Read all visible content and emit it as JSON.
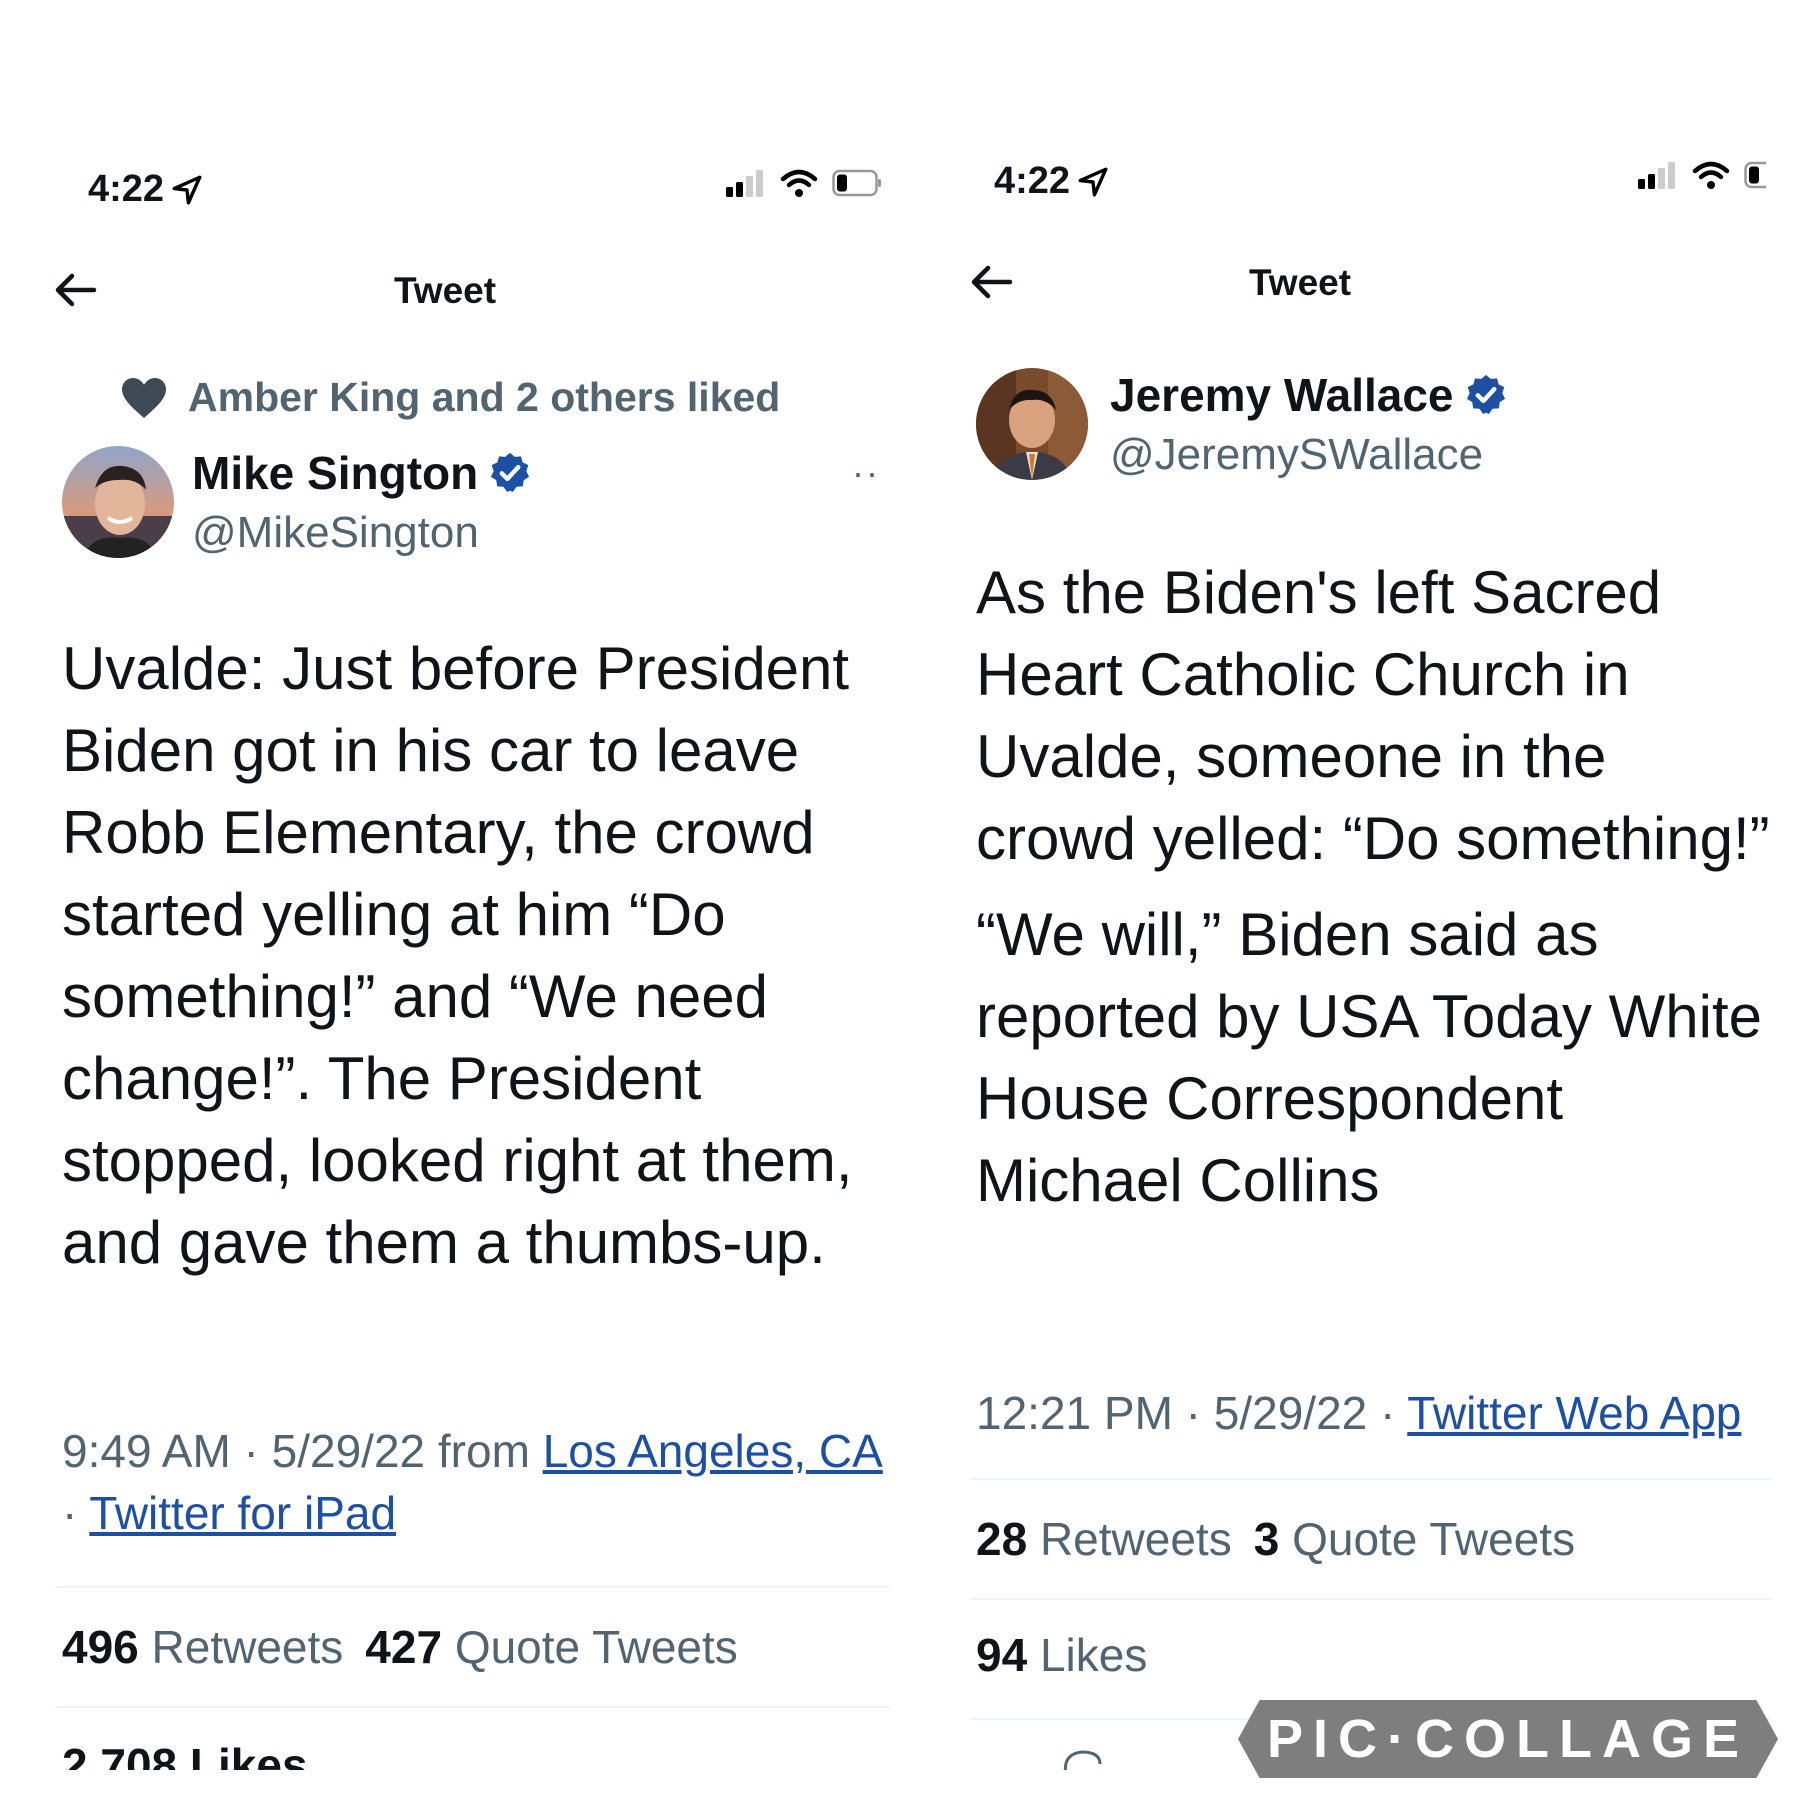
{
  "left": {
    "status": {
      "time": "4:22"
    },
    "nav": {
      "title": "Tweet"
    },
    "social_context": "Amber King and 2 others liked",
    "author": {
      "name": "Mike Sington",
      "handle": "@MikeSington"
    },
    "text": "Uvalde: Just before President Biden got in his car to leave Robb Elementary, the crowd started yelling at him “Do something!” and “We need change!”. The President stopped, looked right at them, and gave them a thumbs-up.",
    "meta": {
      "time": "9:49 AM · 5/29/22 from ",
      "location": "Los Angeles, CA",
      "sep": " · ",
      "source": "Twitter for iPad"
    },
    "stats": {
      "retweets": "496",
      "retweets_label": "Retweets",
      "quotes": "427",
      "quotes_label": "Quote Tweets",
      "likes_partial": "2,708 Likes"
    }
  },
  "right": {
    "status": {
      "time": "4:22"
    },
    "nav": {
      "title": "Tweet"
    },
    "author": {
      "name": "Jeremy Wallace",
      "handle": "@JeremySWallace"
    },
    "text_p1": "As the Biden's left Sacred Heart Catholic Church in Uvalde, someone in the crowd yelled: “Do something!”",
    "text_p2": "“We will,” Biden said as reported by USA Today White House Correspondent Michael Collins",
    "meta": {
      "time": "12:21 PM · 5/29/22 · ",
      "source": "Twitter Web App"
    },
    "stats": {
      "retweets": "28",
      "retweets_label": "Retweets",
      "quotes": "3",
      "quotes_label": "Quote Tweets",
      "likes": "94",
      "likes_label": "Likes"
    }
  },
  "watermark": "PIC·COLLAGE",
  "colors": {
    "link": "#1d4fa3",
    "secondary": "#536471",
    "verified": "#1d4fa3",
    "text": "#0f1419"
  }
}
